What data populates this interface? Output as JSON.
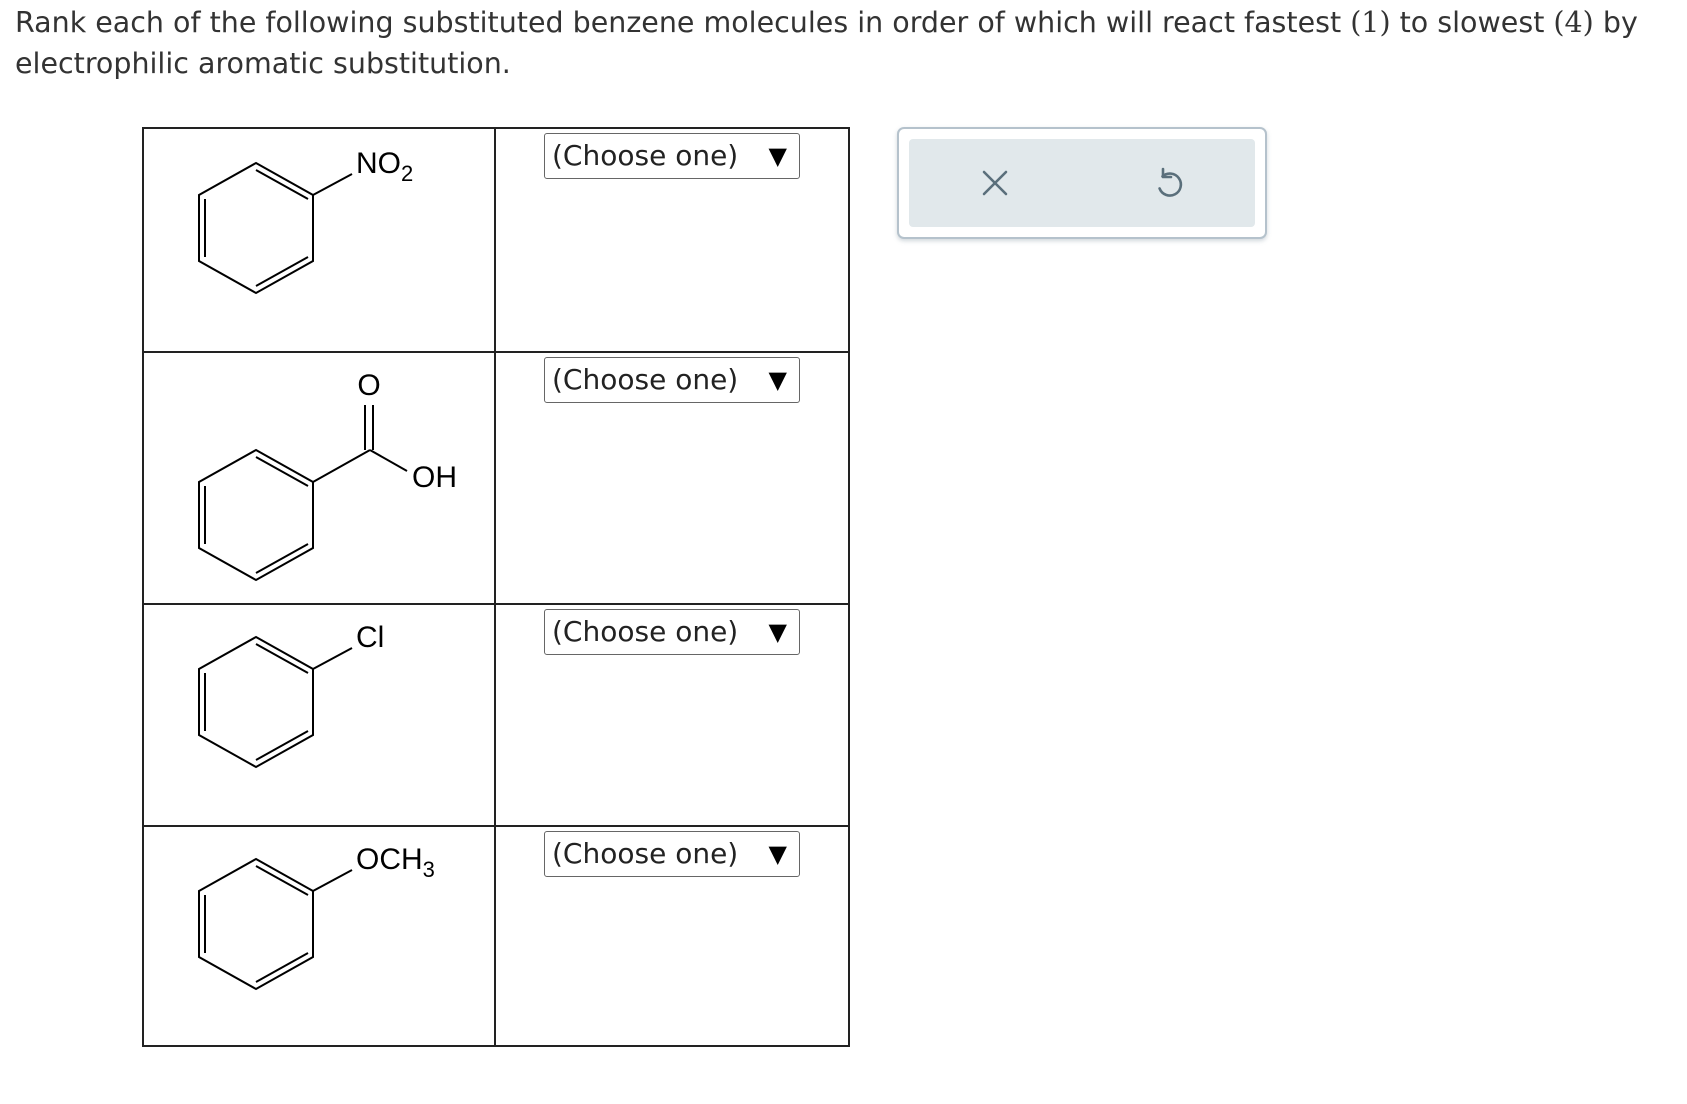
{
  "prompt": {
    "text_before_1": "Rank each of the following substituted benzene molecules in order of which will react fastest ",
    "rank_fastest": "(1)",
    "text_between": " to slowest ",
    "rank_slowest": "(4)",
    "text_after": " by electrophilic aromatic substitution."
  },
  "rows": [
    {
      "substituent": {
        "main": "NO",
        "sub": "2"
      },
      "select_value": "(Choose one)",
      "arrow": "▼"
    },
    {
      "substituent": {
        "carbonyl_o": "O",
        "oh": "OH"
      },
      "select_value": "(Choose one)",
      "arrow": "▼"
    },
    {
      "substituent": {
        "main": "Cl"
      },
      "select_value": "(Choose one)",
      "arrow": "▼"
    },
    {
      "substituent": {
        "main": "OCH",
        "sub": "3"
      },
      "select_value": "(Choose one)",
      "arrow": "▼"
    }
  ],
  "toolbox": {
    "icons": [
      "close-icon",
      "undo-icon"
    ],
    "icon_color": "#5a6f7b",
    "panel_color": "#e1e8eb",
    "border_color": "#b5c2cc"
  }
}
